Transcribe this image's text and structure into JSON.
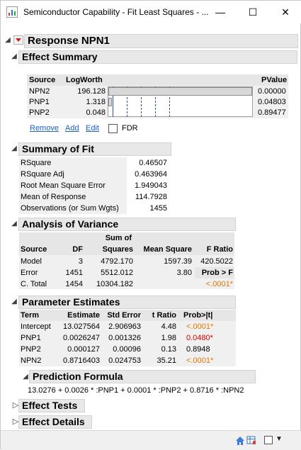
{
  "window": {
    "title": "Semiconductor Capability - Fit Least Squares - ...",
    "min_glyph": "—",
    "max_glyph": "☐",
    "close_glyph": "✕"
  },
  "response": {
    "title": "Response NPN1"
  },
  "effect_summary": {
    "title": "Effect Summary",
    "headers": {
      "source": "Source",
      "logworth": "LogWorth",
      "pvalue": "PValue"
    },
    "rows": [
      {
        "source": "NPN2",
        "logworth": "196.128",
        "pvalue": "0.00000",
        "bar_fraction": 1.0
      },
      {
        "source": "PNP1",
        "logworth": "1.318",
        "pvalue": "0.04803",
        "bar_fraction": 0.0067
      },
      {
        "source": "PNP2",
        "logworth": "0.048",
        "pvalue": "0.89477",
        "bar_fraction": 0.0002
      }
    ],
    "links": {
      "remove": "Remove",
      "add": "Add",
      "edit": "Edit"
    },
    "fdr_label": "FDR"
  },
  "summary_of_fit": {
    "title": "Summary of Fit",
    "rows": [
      {
        "label": "RSquare",
        "value": "0.46507"
      },
      {
        "label": "RSquare Adj",
        "value": "0.463964"
      },
      {
        "label": "Root Mean Square Error",
        "value": "1.949043"
      },
      {
        "label": "Mean of Response",
        "value": "114.7928"
      },
      {
        "label": "Observations (or Sum Wgts)",
        "value": "1455"
      }
    ]
  },
  "anova": {
    "title": "Analysis of Variance",
    "headers": {
      "source": "Source",
      "df": "DF",
      "ss_top": "Sum of",
      "ss_bottom": "Squares",
      "ms": "Mean Square",
      "f": "F Ratio"
    },
    "rows": [
      {
        "source": "Model",
        "df": "3",
        "ss": "4792.170",
        "ms": "1597.39",
        "f": "420.5022"
      },
      {
        "source": "Error",
        "df": "1451",
        "ss": "5512.012",
        "ms": "3.80",
        "f": "Prob > F"
      },
      {
        "source": "C. Total",
        "df": "1454",
        "ss": "10304.182",
        "ms": "",
        "f": "<.0001*"
      }
    ]
  },
  "parameter_estimates": {
    "title": "Parameter Estimates",
    "headers": {
      "term": "Term",
      "estimate": "Estimate",
      "stderr": "Std Error",
      "tratio": "t Ratio",
      "prob": "Prob>|t|"
    },
    "rows": [
      {
        "term": "Intercept",
        "estimate": "13.027564",
        "stderr": "2.906963",
        "tratio": "4.48",
        "prob": "<.0001*"
      },
      {
        "term": "PNP1",
        "estimate": "0.0026247",
        "stderr": "0.001326",
        "tratio": "1.98",
        "prob": "0.0480*"
      },
      {
        "term": "PNP2",
        "estimate": "0.000127",
        "stderr": "0.00096",
        "tratio": "0.13",
        "prob": "0.8948"
      },
      {
        "term": "NPN2",
        "estimate": "0.8716403",
        "stderr": "0.024753",
        "tratio": "35.21",
        "prob": "<.0001*"
      }
    ]
  },
  "prediction_formula": {
    "title": "Prediction Formula",
    "formula": "13.0276 + 0.0026 * :PNP1 + 0.0001 * :PNP2 + 0.8716 * :NPN2"
  },
  "effect_tests": {
    "title": "Effect Tests"
  },
  "effect_details": {
    "title": "Effect Details"
  },
  "colors": {
    "orange": "#e07800",
    "red": "#d00000",
    "link": "#1e5ec8",
    "header_bg": "#e8e8e8"
  }
}
